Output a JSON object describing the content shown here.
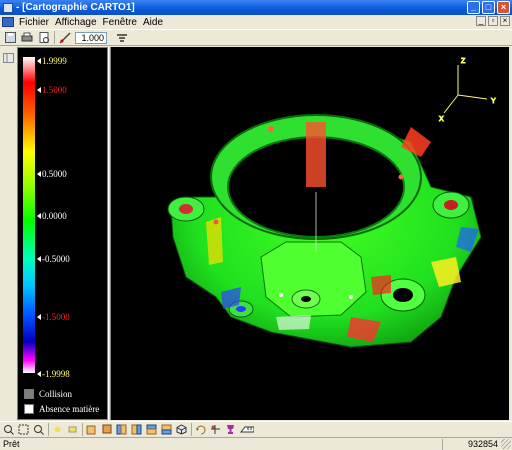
{
  "window": {
    "title": "- [Cartographie CARTO1]"
  },
  "menubar": {
    "items": [
      "Fichier",
      "Affichage",
      "Fenêtre",
      "Aide"
    ]
  },
  "toolbar": {
    "zoom_value": "1.000"
  },
  "legend": {
    "ticks": [
      {
        "label": "1.9999",
        "color": "#ffff66"
      },
      {
        "label": "1.5000",
        "color": "#ff2020"
      },
      {
        "label": "0.5000",
        "color": "#ffffff"
      },
      {
        "label": "0.0000",
        "color": "#ffffff"
      },
      {
        "label": "-0.5000",
        "color": "#ffffff"
      },
      {
        "label": "-1.5000",
        "color": "#ff2020"
      },
      {
        "label": "-1.9998",
        "color": "#ffff66"
      }
    ],
    "collision_label": "Collision",
    "absence_label": "Absence matière",
    "collision_color": "#808080",
    "absence_color": "#ffffff"
  },
  "axes": {
    "x": "X",
    "y": "Y",
    "z": "Z",
    "color": "#ffff66"
  },
  "status": {
    "left": "Prêt",
    "right": "932854"
  }
}
